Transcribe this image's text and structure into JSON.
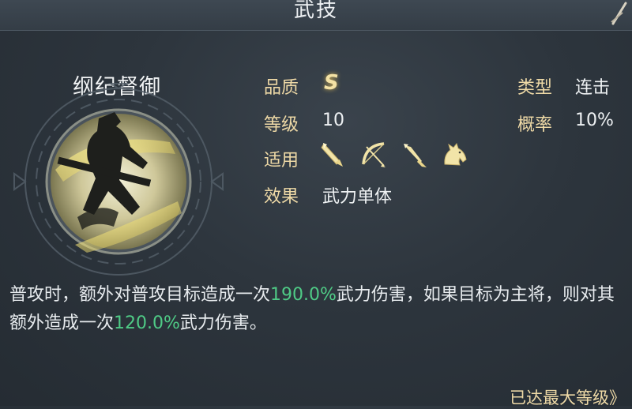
{
  "header": {
    "title": "武技"
  },
  "skill": {
    "name": "纲纪督御",
    "quality_label": "品质",
    "quality_value": "S",
    "level_label": "等级",
    "level_value": "10",
    "applicable_label": "适用",
    "effect_label": "效果",
    "effect_value": "武力单体",
    "type_label": "类型",
    "type_value": "连击",
    "chance_label": "概率",
    "chance_value": "10%",
    "applicable_icons": [
      "sword-icon",
      "bow-icon",
      "spear-icon",
      "horse-icon"
    ]
  },
  "description": {
    "part1": "普攻时，额外对普攻目标造成一次",
    "value1": "190.0%",
    "part2": "武力伤害，如果目标为主将，则对其额外造成一次",
    "value2": "120.0%",
    "part3": "武力伤害。"
  },
  "footer": {
    "max_level": "已达最大等级》"
  },
  "colors": {
    "label": "#eed9a6",
    "highlight": "#4fcb86",
    "quality": "#f4e2a5",
    "background": "#2d353d"
  }
}
